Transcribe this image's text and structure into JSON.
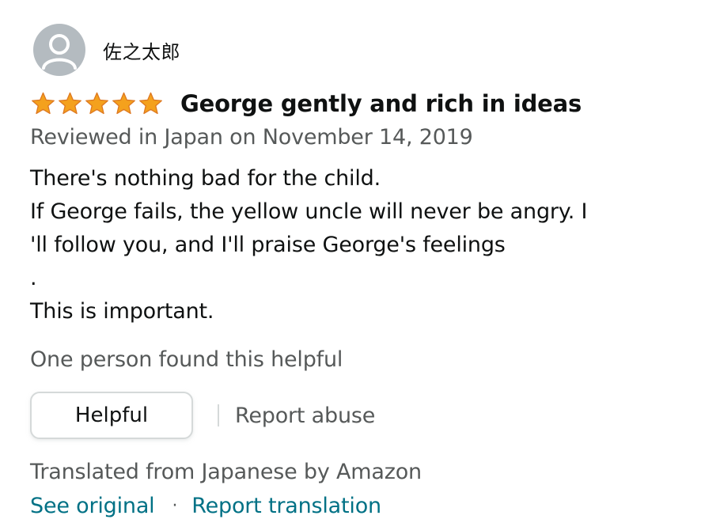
{
  "review": {
    "profile_name": "佐之太郎",
    "rating": 5,
    "rating_max": 5,
    "star_color": "#f4a11d",
    "title": "George gently and rich in ideas",
    "date": "Reviewed in Japan on November 14, 2019",
    "body_lines": [
      "There's nothing bad for the child.",
      "If George fails, the yellow uncle will never be angry. I",
      "'ll follow you, and I'll praise George's feelings",
      ".",
      "This is important."
    ],
    "helpful_count": "One person found this helpful",
    "helpful_button_label": "Helpful",
    "report_abuse_label": "Report abuse",
    "translated_note": "Translated from Japanese by Amazon",
    "see_original_label": "See original",
    "separator": "·",
    "report_translation_label": "Report translation",
    "link_color": "#007185",
    "avatar_icon": "user-silhouette-icon"
  }
}
